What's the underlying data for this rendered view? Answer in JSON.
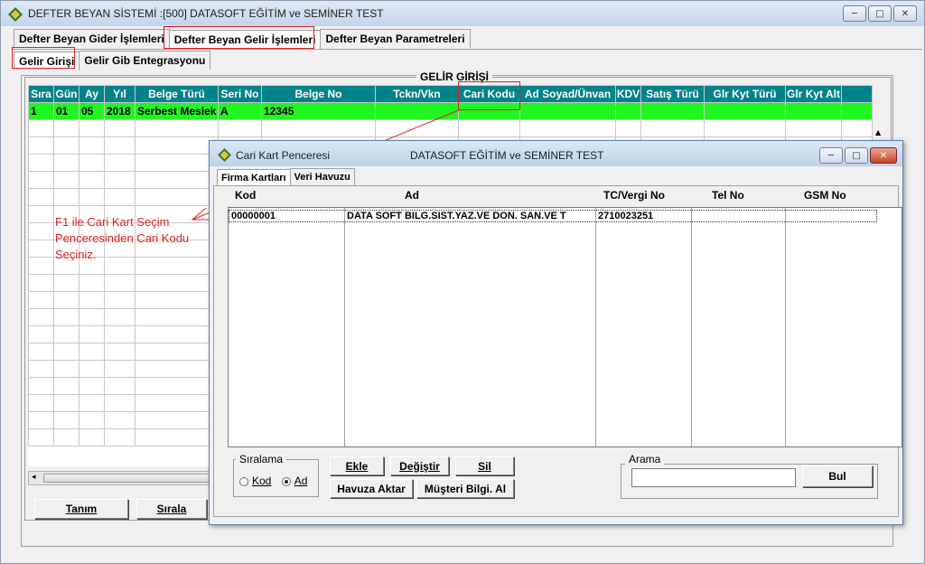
{
  "window": {
    "title": "DEFTER BEYAN SİSTEMİ  :[500]  DATASOFT EĞİTİM ve SEMİNER TEST",
    "minimize": "─",
    "maximize": "□",
    "close": "✕"
  },
  "main_tabs": [
    "Defter Beyan Gider İşlemleri",
    "Defter Beyan Gelir İşlemleri",
    "Defter Beyan Parametreleri"
  ],
  "sub_tabs": [
    "Gelir Girişi",
    "Gelir Gib Entegrasyonu"
  ],
  "group_title": "GELİR GİRİŞİ",
  "grid": {
    "headers": [
      "Sıra",
      "Gün",
      "Ay",
      "Yıl",
      "Belge Türü",
      "Seri No",
      "Belge No",
      "Tckn/Vkn",
      "Cari Kodu",
      "Ad Soyad/Ünvan",
      "KDV",
      "Satış Türü",
      "Glr Kyt Türü",
      "Glr Kyt Alt"
    ],
    "rows": [
      [
        "1",
        "01",
        "05",
        "2018",
        "Serbest Meslek",
        "A",
        "12345",
        "",
        "",
        "",
        "",
        "",
        "",
        ""
      ]
    ]
  },
  "annotation": [
    "F1 ile Cari Kart Seçim",
    "Penceresinden Cari Kodu",
    "Seçiniz."
  ],
  "bottom_buttons": {
    "tanim": "Tanım",
    "sirala": "Sırala"
  },
  "dialog": {
    "title": "Cari Kart Penceresi",
    "company": "DATASOFT EĞİTİM ve SEMİNER TEST",
    "tabs": [
      "Firma Kartları",
      "Veri Havuzu"
    ],
    "columns": [
      "Kod",
      "Ad",
      "TC/Vergi No",
      "Tel No",
      "GSM No"
    ],
    "rows": [
      [
        "00000001",
        "DATA SOFT BILG.SIST.YAZ.VE DON. SAN.VE T",
        "2710023251",
        "",
        ""
      ]
    ],
    "sort_group": "Sıralama",
    "sort_kod": "Kod",
    "sort_ad": "Ad",
    "buttons": {
      "ekle": "Ekle",
      "degistir": "Değiştir",
      "sil": "Sil",
      "havuza_aktar": "Havuza Aktar",
      "musteri_bilgi": "Müşteri Bilgi. Al",
      "bul": "Bul"
    },
    "search_group": "Arama",
    "search_value": ""
  },
  "colors": {
    "header_teal": "#00848a",
    "selected_row": "#21f521",
    "annotation_red": "#e02020"
  }
}
